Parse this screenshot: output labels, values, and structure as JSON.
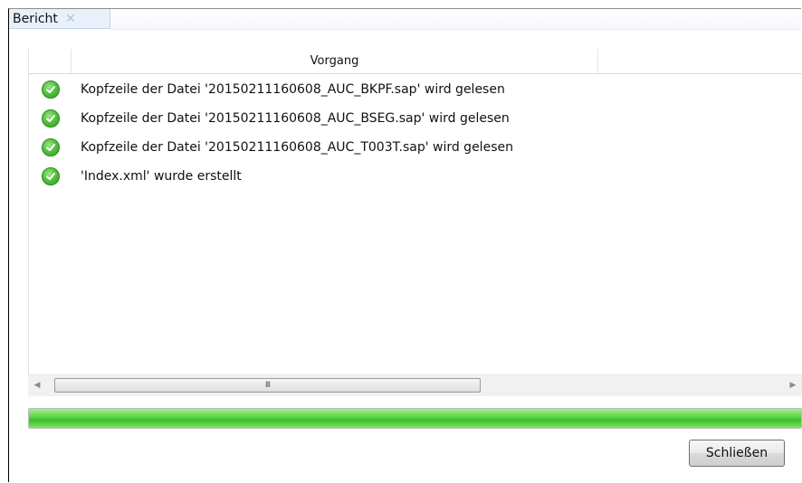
{
  "tab": {
    "label": "Bericht",
    "close_glyph": "✕"
  },
  "grid": {
    "columns": [
      "",
      "Vorgang",
      ""
    ],
    "rows": [
      {
        "status_icon": "check-circle-icon",
        "text": "Kopfzeile der Datei '20150211160608_AUC_BKPF.sap' wird gelesen"
      },
      {
        "status_icon": "check-circle-icon",
        "text": "Kopfzeile der Datei '20150211160608_AUC_BSEG.sap' wird gelesen"
      },
      {
        "status_icon": "check-circle-icon",
        "text": "Kopfzeile der Datei '20150211160608_AUC_T003T.sap' wird gelesen"
      },
      {
        "status_icon": "check-circle-icon",
        "text": "'Index.xml' wurde erstellt"
      }
    ]
  },
  "scrollbar": {
    "left_arrow": "◀",
    "right_arrow": "▶",
    "grip": "III"
  },
  "progress": {
    "value": 1.0,
    "color": "#4cc83a"
  },
  "buttons": {
    "close_label": "Schließen"
  }
}
